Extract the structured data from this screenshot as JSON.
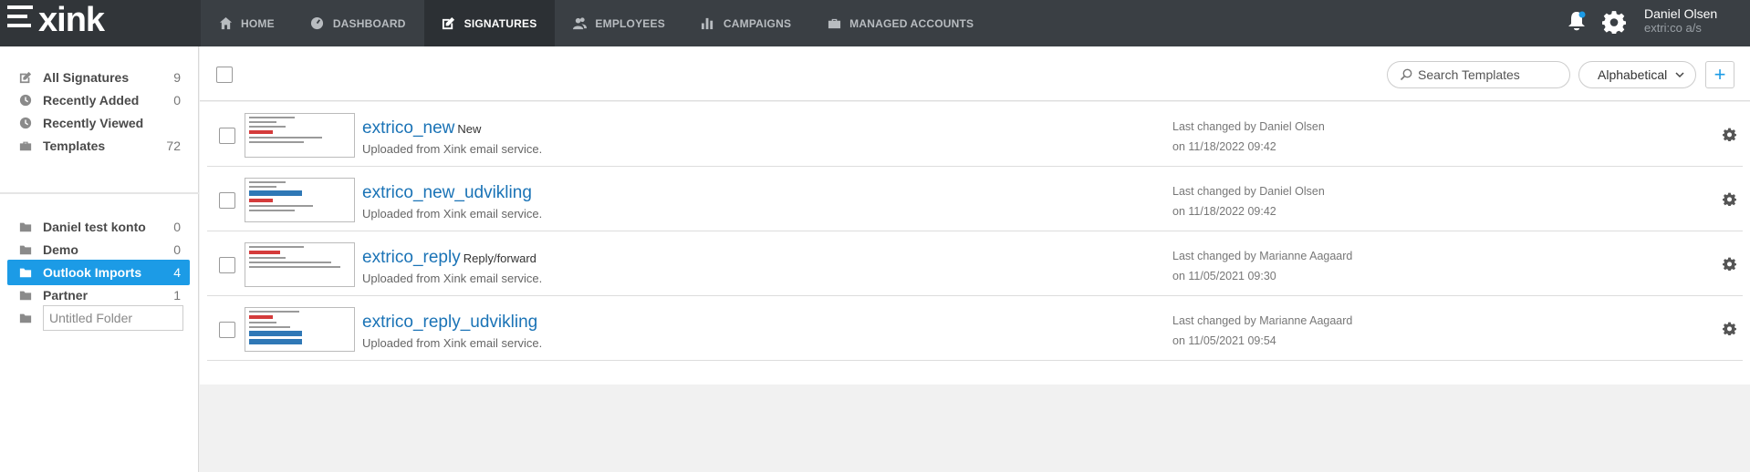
{
  "brand": {
    "logo_text": "xink"
  },
  "nav": [
    {
      "label": "HOME",
      "icon": "home-icon"
    },
    {
      "label": "DASHBOARD",
      "icon": "dashboard-icon"
    },
    {
      "label": "SIGNATURES",
      "icon": "edit-icon",
      "active": true
    },
    {
      "label": "EMPLOYEES",
      "icon": "users-icon"
    },
    {
      "label": "CAMPAIGNS",
      "icon": "bar-chart-icon"
    },
    {
      "label": "MANAGED ACCOUNTS",
      "icon": "briefcase-icon"
    }
  ],
  "user": {
    "name": "Daniel Olsen",
    "company": "extri:co a/s"
  },
  "sidebar": {
    "filters": [
      {
        "label": "All Signatures",
        "count": "9",
        "icon": "edit-icon"
      },
      {
        "label": "Recently Added",
        "count": "0",
        "icon": "clock-icon"
      },
      {
        "label": "Recently Viewed",
        "count": "",
        "icon": "clock-icon"
      },
      {
        "label": "Templates",
        "count": "72",
        "icon": "briefcase-icon"
      }
    ],
    "folders": [
      {
        "label": "Daniel test konto",
        "count": "0"
      },
      {
        "label": "Demo",
        "count": "0"
      },
      {
        "label": "Outlook Imports",
        "count": "4",
        "active": true
      },
      {
        "label": "Partner",
        "count": "1"
      }
    ],
    "new_folder_placeholder": "Untitled Folder"
  },
  "toolbar": {
    "search_placeholder": "Search Templates",
    "sort_label": "Alphabetical",
    "add_label": "+"
  },
  "signatures": [
    {
      "name": "extrico_new",
      "tag": "New",
      "description": "Uploaded from Xink email service.",
      "changed_by": "Last changed by Daniel Olsen",
      "changed_on": "on 11/18/2022 09:42"
    },
    {
      "name": "extrico_new_udvikling",
      "tag": "",
      "description": "Uploaded from Xink email service.",
      "changed_by": "Last changed by Daniel Olsen",
      "changed_on": "on 11/18/2022 09:42"
    },
    {
      "name": "extrico_reply",
      "tag": "Reply/forward",
      "description": "Uploaded from Xink email service.",
      "changed_by": "Last changed by Marianne Aagaard",
      "changed_on": "on 11/05/2021 09:30"
    },
    {
      "name": "extrico_reply_udvikling",
      "tag": "",
      "description": "Uploaded from Xink email service.",
      "changed_by": "Last changed by Marianne Aagaard",
      "changed_on": "on 11/05/2021 09:54"
    }
  ],
  "colors": {
    "accent": "#1c9be6",
    "topbar": "#3a3f44",
    "link": "#1a73b6"
  }
}
